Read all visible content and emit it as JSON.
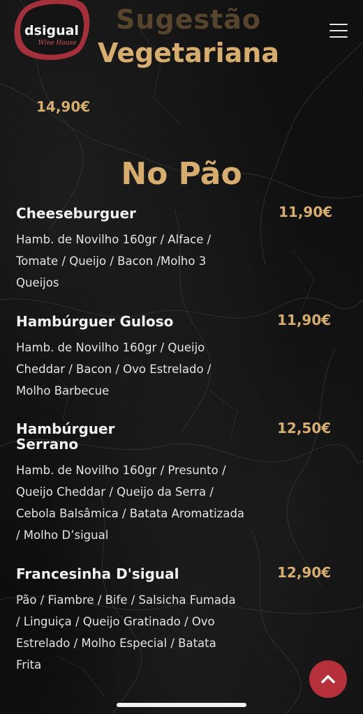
{
  "header": {
    "logo_text": "dsigual",
    "logo_subtext": "Wine House",
    "menu_icon": "hamburger-menu-icon"
  },
  "sections": [
    {
      "title_line1": "Sugestão",
      "title_line2": "Vegetariana",
      "price": "14,90€"
    },
    {
      "title": "No Pão"
    }
  ],
  "items": [
    {
      "name": "Cheeseburguer",
      "price": "11,90€",
      "desc_lines": [
        "Hamb. de Novilho 160gr / Alface /",
        "Tomate / Queijo / Bacon /Molho 3",
        "Queijos"
      ]
    },
    {
      "name": "Hambúrguer Guloso",
      "price": "11,90€",
      "desc_lines": [
        "Hamb. de Novilho 160gr / Queijo",
        "Cheddar / Bacon / Ovo Estrelado /",
        "Molho Barbecue"
      ]
    },
    {
      "name_line1": "Hambúrguer",
      "name_line2": "Serrano",
      "price": "12,50€",
      "desc_lines": [
        "Hamb. de Novilho 160gr / Presunto /",
        "Queijo Cheddar / Queijo da Serra /",
        "Cebola Balsâmica / Batata Aromatizada",
        "/ Molho D’sigual"
      ]
    },
    {
      "name": "Francesinha D'sigual",
      "price": "12,90€",
      "desc_lines": [
        "Pão / Fiambre / Bife / Salsicha Fumada",
        "/ Linguiça / Queijo Gratinado / Ovo",
        "Estrelado / Molho Especial / Batata",
        "Frita"
      ]
    }
  ],
  "colors": {
    "accent": "#d6ad6f",
    "logo_red": "#a3303b",
    "button_red": "#b5303a",
    "background": "#0b0b0b"
  },
  "scroll_top_icon": "chevron-up-icon"
}
